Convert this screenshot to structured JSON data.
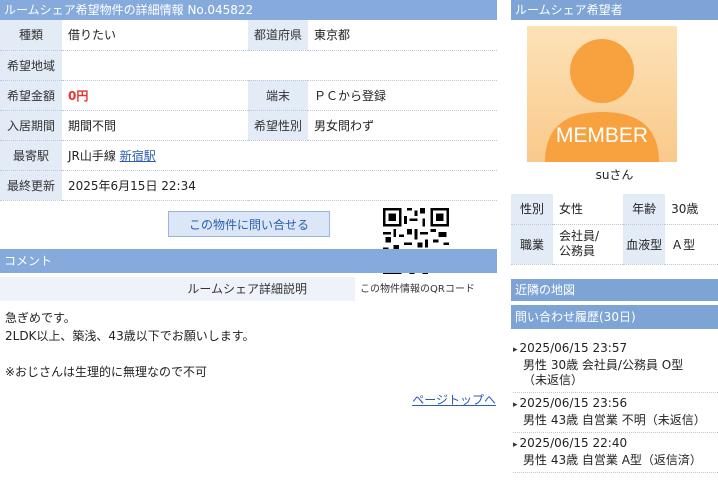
{
  "main_title": "ルームシェア希望物件の詳細情報 No.045822",
  "details": {
    "type_label": "種類",
    "type_value": "借りたい",
    "pref_label": "都道府県",
    "pref_value": "東京都",
    "area_label": "希望地域",
    "area_value": "",
    "price_label": "希望金額",
    "price_value": "0円",
    "device_label": "端末",
    "device_value": "ＰＣから登録",
    "period_label": "入居期間",
    "period_value": "期間不問",
    "gender_label": "希望性別",
    "gender_value": "男女問わず",
    "station_label": "最寄駅",
    "station_line": "JR山手線",
    "station_name": "新宿駅",
    "updated_label": "最終更新",
    "updated_value": "2025年6月15日 22:34"
  },
  "contact_button": "この物件に問い合せる",
  "qr_caption": "この物件情報のQRコード",
  "comment_header": "コメント",
  "comment_subheader": "ルームシェア詳細説明",
  "comment_lines": [
    "急ぎめです。",
    "2LDK以上、築浅、43歳以下でお願いします。",
    "",
    "※おじさんは生理的に無理なので不可"
  ],
  "page_top": "ページトップへ",
  "sidebar": {
    "title": "ルームシェア希望者",
    "avatar_text": "MEMBER",
    "username": "suさん",
    "profile": {
      "sex_label": "性別",
      "sex_value": "女性",
      "age_label": "年齢",
      "age_value": "30歳",
      "job_label": "職業",
      "job_value_1": "会社員/",
      "job_value_2": "公務員",
      "blood_label": "血液型",
      "blood_value": "Ａ型"
    },
    "map_header": "近隣の地図",
    "history_header": "問い合わせ履歴(30日)",
    "history": [
      {
        "date": "2025/06/15 23:57",
        "desc1": "男性 30歳 会社員/公務員 O型",
        "desc2": "（未返信）"
      },
      {
        "date": "2025/06/15 23:56",
        "desc1": "男性 43歳 自営業 不明（未返信）",
        "desc2": ""
      },
      {
        "date": "2025/06/15 22:40",
        "desc1": "男性 43歳 自営業 A型（返信済）",
        "desc2": ""
      }
    ]
  }
}
